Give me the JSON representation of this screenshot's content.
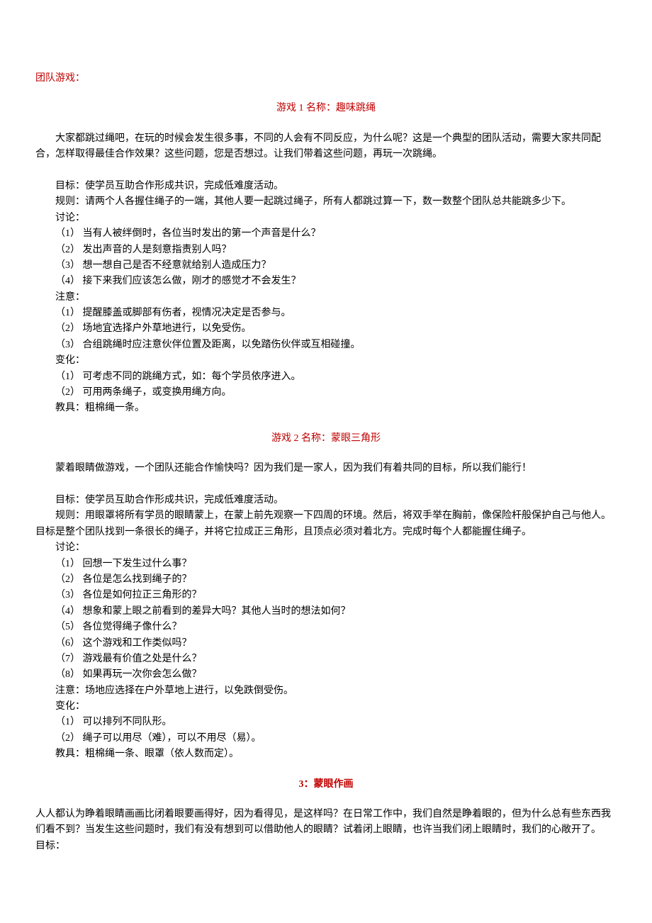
{
  "header": "团队游戏：",
  "game1": {
    "title": "游戏 1 名称：趣味跳绳",
    "intro": "大家都跳过绳吧，在玩的时候会发生很多事，不同的人会有不同反应，为什么呢？这是一个典型的团队活动，需要大家共同配合，怎样取得最佳合作效果？这些问题，您是否想过。让我们带着这些问题，再玩一次跳绳。",
    "goal_label": "目标：",
    "goal": "使学员互助合作形成共识，完成低难度活动。",
    "rule_label": "规则：",
    "rule": "请两个人各握住绳子的一端，其他人要一起跳过绳子，所有人都跳过算一下，数一数整个团队总共能跳多少下。",
    "discuss_label": "讨论：",
    "discuss": [
      "（1）  当有人被绊倒时，各位当时发出的第一个声音是什么？",
      "（2）  发出声音的人是刻意指责别人吗？",
      "（3）  想一想自己是否不经意就给别人造成压力？",
      "（4）  接下来我们应该怎么做，刚才的感觉才不会发生？"
    ],
    "note_label": "注意：",
    "notes": [
      "（1）  提醒膝盖或脚部有伤者，视情况决定是否参与。",
      "（2）  场地宜选择户外草地进行，以免受伤。",
      "（3）  合组跳绳时应注意伙伴位置及距离，以免踏伤伙伴或互相碰撞。"
    ],
    "change_label": "变化：",
    "changes": [
      "（1）  可考虑不同的跳绳方式，如：每个学员依序进入。",
      "（2）  可用两条绳子，或变换用绳方向。"
    ],
    "tool_label": "教具：",
    "tool": "粗棉绳一条。"
  },
  "game2": {
    "title": "游戏 2 名称：蒙眼三角形",
    "intro": "蒙着眼睛做游戏，一个团队还能合作愉快吗？因为我们是一家人，因为我们有着共同的目标，所以我们能行！",
    "goal_label": "目标：",
    "goal": "使学员互助合作形成共识，完成低难度活动。",
    "rule_label": "规则：",
    "rule": "用眼罩将所有学员的眼睛蒙上，在蒙上前先观察一下四周的环境。然后，将双手举在胸前，像保险杆般保护自己与他人。目标是整个团队找到一条很长的绳子，并将它拉成正三角形，且顶点必须对着北方。完成时每个人都能握住绳子。",
    "discuss_label": "讨论：",
    "discuss": [
      "（1）  回想一下发生过什么事？",
      "（2）  各位是怎么找到绳子的？",
      "（3）  各位是如何拉正三角形的？",
      "（4）  想象和蒙上眼之前看到的差异大吗？其他人当时的想法如何？",
      "（5）  各位觉得绳子像什么？",
      "（6）  这个游戏和工作类似吗？",
      "（7）  游戏最有价值之处是什么？",
      "（8）  如果再玩一次你会怎么做？"
    ],
    "note_label": "注意：",
    "note": "场地应选择在户外草地上进行，以免跌倒受伤。",
    "change_label": "变化：",
    "changes": [
      "（1）  可以排列不同队形。",
      "（2）  绳子可以用尽（难），可以不用尽（易）。"
    ],
    "tool_label": "教具：",
    "tool": "粗棉绳一条、眼罩（依人数而定）。"
  },
  "game3": {
    "title": "3：蒙眼作画",
    "intro": "人人都认为睁着眼睛画画比闭着眼要画得好，因为看得见，是这样吗？在日常工作中，我们自然是睁着眼的，但为什么总有些东西我们看不到？当发生这些问题时，我们有没有想到可以借助他人的眼睛？试着闭上眼睛，也许当我们闭上眼睛时，我们的心敞开了。",
    "goal_label": "目标："
  }
}
